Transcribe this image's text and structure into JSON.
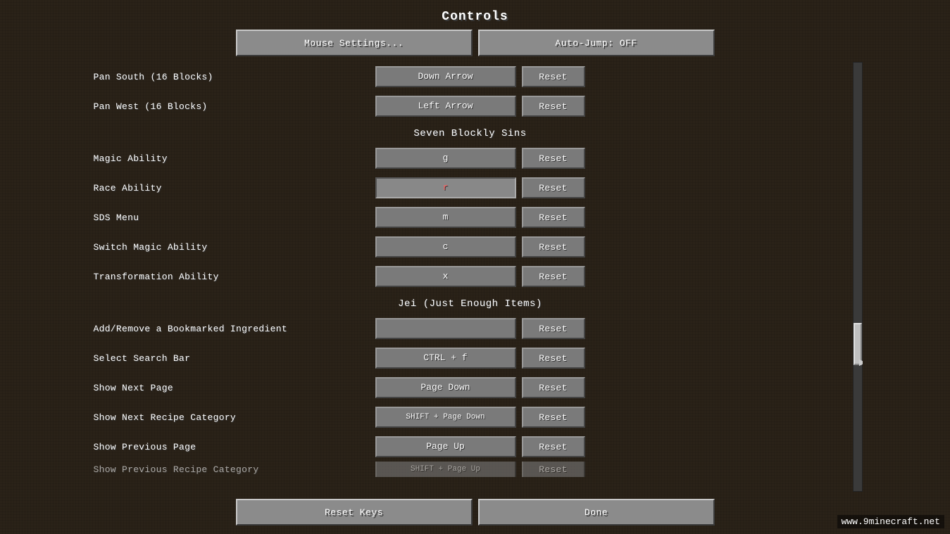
{
  "title": "Controls",
  "topButtons": {
    "mouseSettings": "Mouse Settings...",
    "autoJump": "Auto-Jump: OFF"
  },
  "sections": [
    {
      "id": "top-partial",
      "rows": [
        {
          "label": "Pan South (16 Blocks)",
          "key": "Down Arrow",
          "keyColor": "normal",
          "reset": "Reset"
        },
        {
          "label": "Pan West (16 Blocks)",
          "key": "Left Arrow",
          "keyColor": "normal",
          "reset": "Reset"
        }
      ]
    },
    {
      "id": "seven-blockly-sins",
      "header": "Seven Blockly Sins",
      "rows": [
        {
          "label": "Magic Ability",
          "key": "g",
          "keyColor": "normal",
          "reset": "Reset"
        },
        {
          "label": "Race Ability",
          "key": "r",
          "keyColor": "red",
          "reset": "Reset"
        },
        {
          "label": "SDS Menu",
          "key": "m",
          "keyColor": "normal",
          "reset": "Reset"
        },
        {
          "label": "Switch Magic Ability",
          "key": "c",
          "keyColor": "normal",
          "reset": "Reset"
        },
        {
          "label": "Transformation Ability",
          "key": "x",
          "keyColor": "normal",
          "reset": "Reset"
        }
      ]
    },
    {
      "id": "jei",
      "header": "Jei (Just Enough Items)",
      "rows": [
        {
          "label": "Add/Remove a Bookmarked Ingredient",
          "key": "",
          "keyColor": "normal",
          "reset": "Reset"
        },
        {
          "label": "Select Search Bar",
          "key": "CTRL + f",
          "keyColor": "normal",
          "reset": "Reset"
        },
        {
          "label": "Show Next Page",
          "key": "Page Down",
          "keyColor": "normal",
          "reset": "Reset"
        },
        {
          "label": "Show Next Recipe Category",
          "key": "SHIFT + Page Down",
          "keyColor": "normal",
          "reset": "Reset"
        },
        {
          "label": "Show Previous Page",
          "key": "Page Up",
          "keyColor": "normal",
          "reset": "Reset"
        }
      ]
    }
  ],
  "partialRow": {
    "label": "Show Previous Recipe Category",
    "key": "SHIFT + Page Up",
    "reset": "Reset"
  },
  "bottomButtons": {
    "resetKeys": "Reset Keys",
    "done": "Done"
  },
  "watermark": "www.9minecraft.net"
}
